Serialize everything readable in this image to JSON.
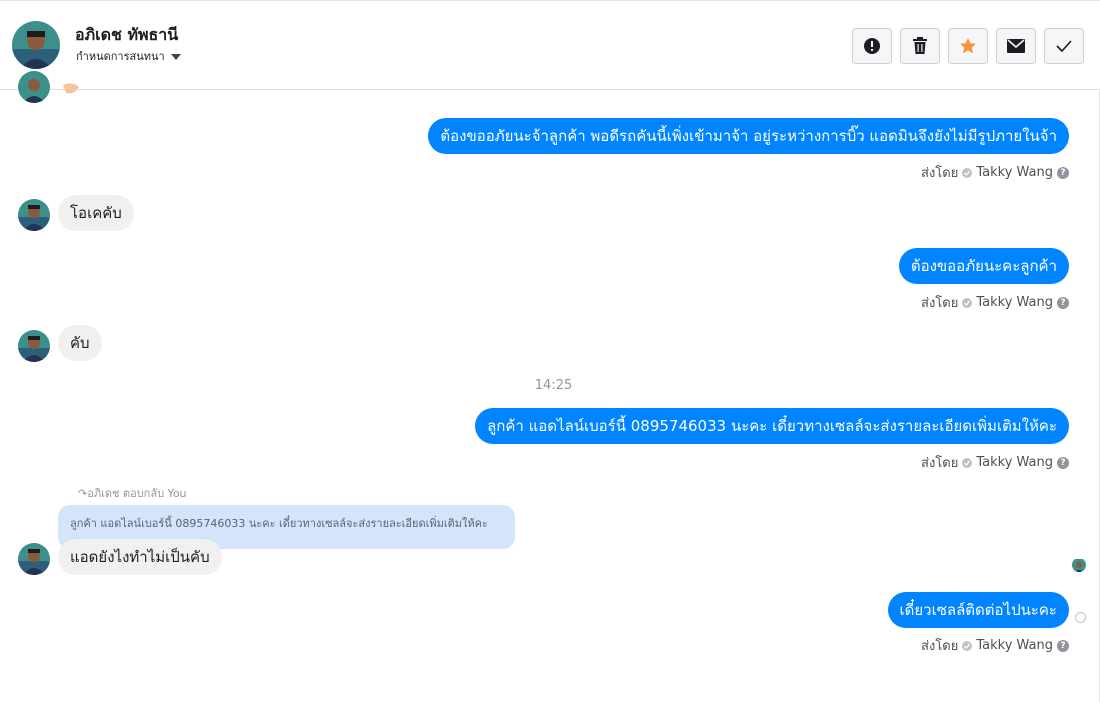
{
  "header": {
    "name": "อภิเดช ทัพธานี",
    "subtitle": "กำหนดการสนทนา",
    "actions": [
      {
        "icon": "alert-icon",
        "name": "report-button"
      },
      {
        "icon": "trash-icon",
        "name": "delete-button"
      },
      {
        "icon": "star-icon",
        "name": "star-button"
      },
      {
        "icon": "envelope-icon",
        "name": "mark-unread-button"
      },
      {
        "icon": "check-icon",
        "name": "mark-done-button"
      }
    ]
  },
  "colors": {
    "outgoing_bubble": "#0084ff",
    "incoming_bubble": "#f1f0f0",
    "reply_quote": "#d4e4fb",
    "star": "#f7923b"
  },
  "messages": {
    "m1": {
      "text": "ต้องขออภัยนะจ้าลูกค้า พอดีรถคันนี้เพิ่งเข้ามาจ้า อยู่ระหว่างการบิ๊ว แอดมินจึงยังไม่มีรูปภายในจ้า",
      "sent_by_label": "ส่งโดย",
      "sender": "Takky Wang"
    },
    "m2": {
      "text": "โอเคคับ"
    },
    "m3": {
      "text": "ต้องขออภัยนะคะลูกค้า",
      "sent_by_label": "ส่งโดย",
      "sender": "Takky Wang"
    },
    "m4": {
      "text": "คับ"
    },
    "time": "14:25",
    "m5": {
      "text": "ลูกค้า แอดไลน์เบอร์นี้ 0895746033 นะคะ เดี๋ยวทางเซลล์จะส่งรายละเอียดเพิ่มเติมให้คะ",
      "sent_by_label": "ส่งโดย",
      "sender": "Takky Wang"
    },
    "m6": {
      "reply_label": "อภิเดช ตอบกลับ You",
      "quoted": "ลูกค้า แอดไลน์เบอร์นี้ 0895746033 นะคะ เดี๋ยวทางเซลล์จะส่งรายละเอียดเพิ่มเติมให้คะ",
      "text": "แอดยังไงทำไม่เป็นคับ"
    },
    "m7": {
      "text": "เดี๋ยวเซลล์ติดต่อไปนะคะ",
      "sent_by_label": "ส่งโดย",
      "sender": "Takky Wang"
    }
  }
}
